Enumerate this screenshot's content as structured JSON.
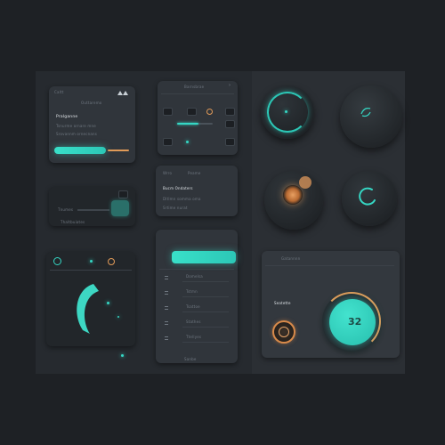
{
  "colors": {
    "background": "#1e2125",
    "board": "#262a2f",
    "card": "#30353b",
    "accent": "#35d7c4",
    "orange": "#e09a58"
  },
  "card1": {
    "header_left": "Caltt",
    "header_mid": "Outtaremo",
    "title": "Pralganne",
    "line1": "Tsnurme ornare mne",
    "line2": "Srovannm ornecnans",
    "signal_icon": "signal-icon"
  },
  "card2": {
    "header": "Barnsbrae"
  },
  "card3": {
    "label": "Tnumes",
    "footer": "Thaltbuiates"
  },
  "card4": {
    "header_a": "Wrro",
    "header_b": "Peame",
    "title": "Bucm Ondaters",
    "line1": "Dltlmn somma oma",
    "line2": "Srtime nurat"
  },
  "card6": {
    "rows": [
      {
        "icon": "arrow-icon",
        "label": "Domelsa"
      },
      {
        "icon": "menu-icon",
        "label": "Tstmn"
      },
      {
        "icon": "list-icon",
        "label": "Tsattoe"
      },
      {
        "icon": "list-icon",
        "label": "Stathes"
      },
      {
        "icon": "list-icon",
        "label": "Ttellyes"
      }
    ],
    "footer": "Sanbe"
  },
  "card7": {
    "label": "Gatannnn",
    "panel_title": "Seatette",
    "dial_value": "32"
  }
}
